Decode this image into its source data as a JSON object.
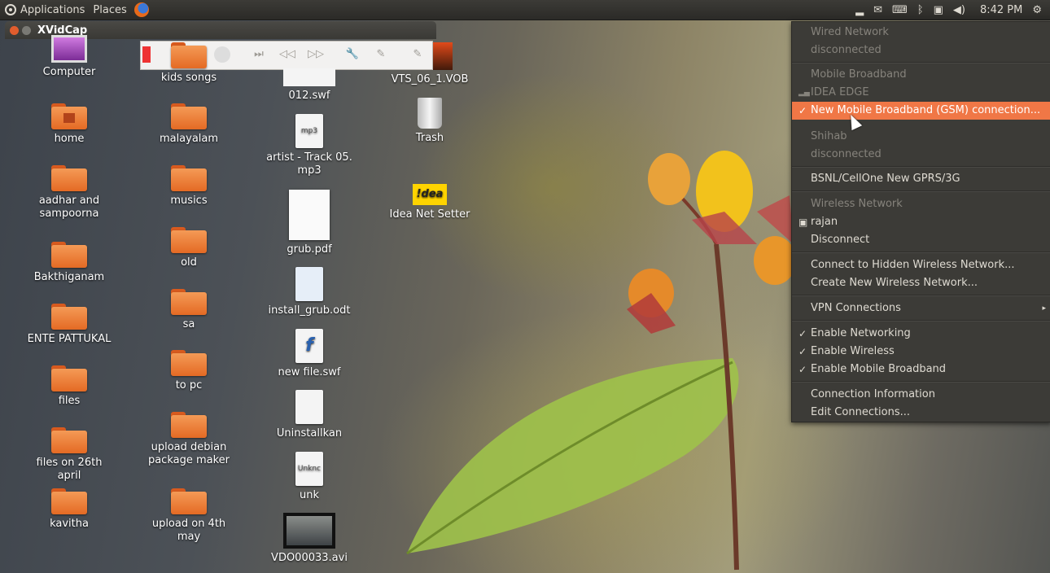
{
  "panel": {
    "applications": "Applications",
    "places": "Places",
    "clock": "8:42 PM",
    "tray_icons": [
      "battery-icon",
      "mail-icon",
      "keyboard-icon",
      "bluetooth-icon",
      "network-icon",
      "volume-icon",
      "gear-icon"
    ]
  },
  "xvidcap": {
    "title": "XVidCap"
  },
  "desktop": {
    "col1": [
      "Computer",
      "home",
      "aadhar and sampoorna",
      "Bakthiganam",
      "ENTE PATTUKAL",
      "files",
      "files on 26th april",
      "kavitha"
    ],
    "col2": [
      "kids songs",
      "malayalam",
      "musics",
      "old",
      "sa",
      "to pc",
      "upload debian package maker",
      "upload on 4th may"
    ],
    "col3": [
      "012.swf",
      "artist - Track 05. mp3",
      "grub.pdf",
      "install_grub.odt",
      "new file.swf",
      "Uninstallkan",
      "unk",
      "VDO00033.avi"
    ],
    "col4": [
      "VTS_06_1.VOB",
      "Trash",
      "Idea Net Setter"
    ],
    "icon_text": {
      "mp3": "mp3",
      "unk": "Unknc",
      "idea": "!dea"
    }
  },
  "network_menu": {
    "wired_header": "Wired Network",
    "wired_status": "disconnected",
    "mobile_header": "Mobile Broadband",
    "mobile_idea": "IDEA EDGE",
    "new_mobile": "New Mobile Broadband (GSM) connection...",
    "shihab": "Shihab",
    "shihab_status": "disconnected",
    "bsnl": "BSNL/CellOne New GPRS/3G",
    "wireless_header": "Wireless Network",
    "rajan": "rajan",
    "disconnect": "Disconnect",
    "connect_hidden": "Connect to Hidden Wireless Network...",
    "create_new": "Create New Wireless Network...",
    "vpn": "VPN Connections",
    "enable_networking": "Enable Networking",
    "enable_wireless": "Enable Wireless",
    "enable_mobile": "Enable Mobile Broadband",
    "connection_info": "Connection Information",
    "edit_connections": "Edit Connections...",
    "check": "✓",
    "submenu_arrow": "▸"
  }
}
